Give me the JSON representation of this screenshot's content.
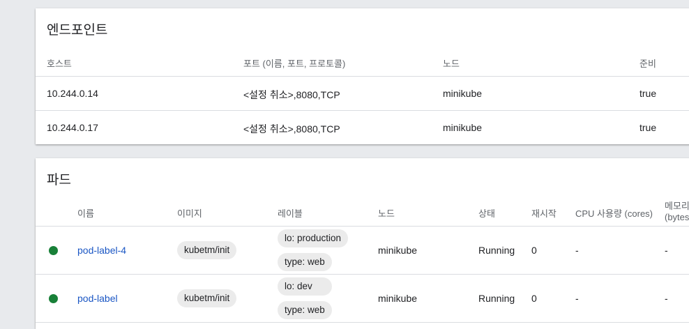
{
  "endpoints": {
    "title": "엔드포인트",
    "columns": [
      "호스트",
      "포트 (이름, 포트, 프로토콜)",
      "노드",
      "준비"
    ],
    "rows": [
      {
        "host": "10.244.0.14",
        "ports": "<설정 취소>,8080,TCP",
        "node": "minikube",
        "ready": "true"
      },
      {
        "host": "10.244.0.17",
        "ports": "<설정 취소>,8080,TCP",
        "node": "minikube",
        "ready": "true"
      }
    ]
  },
  "pods": {
    "title": "파드",
    "columns": {
      "name": "이름",
      "image": "이미지",
      "labels": "레이블",
      "node": "노드",
      "status": "상태",
      "restarts": "재시작",
      "cpu": "CPU 사용량 (cores)",
      "memory_line1": "메모리",
      "memory_line2": "(bytes"
    },
    "status_color": "#188038",
    "rows": [
      {
        "name": "pod-label-4",
        "image": "kubetm/init",
        "labels": [
          "lo: production",
          "type: web"
        ],
        "node": "minikube",
        "status": "Running",
        "restarts": "0",
        "cpu": "-",
        "memory": "-"
      },
      {
        "name": "pod-label",
        "image": "kubetm/init",
        "labels": [
          "lo: dev",
          "type: web"
        ],
        "node": "minikube",
        "status": "Running",
        "restarts": "0",
        "cpu": "-",
        "memory": "-"
      }
    ]
  }
}
